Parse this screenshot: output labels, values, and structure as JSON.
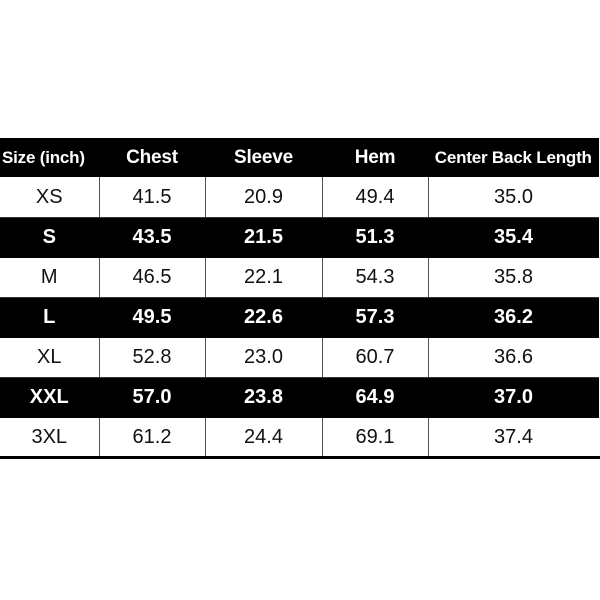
{
  "table": {
    "columns": [
      {
        "key": "size",
        "label": "Size  (inch)"
      },
      {
        "key": "chest",
        "label": "Chest"
      },
      {
        "key": "sleeve",
        "label": "Sleeve"
      },
      {
        "key": "hem",
        "label": "Hem"
      },
      {
        "key": "cbl",
        "label": "Center Back Length"
      }
    ],
    "rows": [
      {
        "style": "light",
        "size": "XS",
        "chest": "41.5",
        "sleeve": "20.9",
        "hem": "49.4",
        "cbl": "35.0"
      },
      {
        "style": "dark",
        "size": "S",
        "chest": "43.5",
        "sleeve": "21.5",
        "hem": "51.3",
        "cbl": "35.4"
      },
      {
        "style": "light",
        "size": "M",
        "chest": "46.5",
        "sleeve": "22.1",
        "hem": "54.3",
        "cbl": "35.8"
      },
      {
        "style": "dark",
        "size": "L",
        "chest": "49.5",
        "sleeve": "22.6",
        "hem": "57.3",
        "cbl": "36.2"
      },
      {
        "style": "light",
        "size": "XL",
        "chest": "52.8",
        "sleeve": "23.0",
        "hem": "60.7",
        "cbl": "36.6"
      },
      {
        "style": "dark",
        "size": "XXL",
        "chest": "57.0",
        "sleeve": "23.8",
        "hem": "64.9",
        "cbl": "37.0"
      },
      {
        "style": "light",
        "size": "3XL",
        "chest": "61.2",
        "sleeve": "24.4",
        "hem": "69.1",
        "cbl": "37.4"
      }
    ]
  },
  "colors": {
    "background": "#ffffff",
    "header_background": "#000000",
    "header_text": "#ffffff",
    "dark_row_background": "#000000",
    "dark_row_text": "#ffffff",
    "light_row_background": "#ffffff",
    "light_row_text": "#111111",
    "grid_line": "#555555"
  }
}
